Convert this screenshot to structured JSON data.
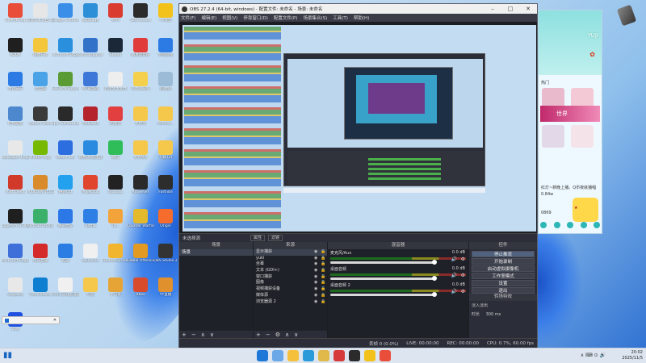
{
  "desktop": {
    "icons": [
      {
        "label": "Everything",
        "color": "#e84e3a"
      },
      {
        "label": "新建文本文档 (5).txt",
        "color": "#e6e6e6"
      },
      {
        "label": "Google Chrome",
        "color": "#3a8ee8"
      },
      {
        "label": "微软Edge",
        "color": "#2d8fd8"
      },
      {
        "label": "WPS",
        "color": "#d93b2f"
      },
      {
        "label": "OBS Studio",
        "color": "#2b2b2b"
      },
      {
        "label": "YY语音",
        "color": "#f2c21b"
      },
      {
        "label": "KOOK",
        "color": "#1f1f1f"
      },
      {
        "label": "快捷方式",
        "color": "#f3c63c"
      },
      {
        "label": "Microsoft Edge",
        "color": "#2a90dd"
      },
      {
        "label": "control_panel",
        "color": "#3272c9"
      },
      {
        "label": "Steam",
        "color": "#1b2838"
      },
      {
        "label": "网易云音乐",
        "color": "#e13c3c"
      },
      {
        "label": "夸克网盘",
        "color": "#2c7be5"
      },
      {
        "label": "更新日志",
        "color": "#2c7be5"
      },
      {
        "label": "此电脑",
        "color": "#4aa3e6"
      },
      {
        "label": "GeForce Experience",
        "color": "#5b9b34"
      },
      {
        "label": "MT管理器",
        "color": "#3d78d8"
      },
      {
        "label": "新建文本文档",
        "color": "#eeeeee"
      },
      {
        "label": "VirtualBox",
        "color": "#f5d04c"
      },
      {
        "label": "回收站",
        "color": "#9cbbd6"
      },
      {
        "label": "控制面板",
        "color": "#4d88cf"
      },
      {
        "label": "Nature Calls",
        "color": "#3a3a3a"
      },
      {
        "label": "Epic Games Launcher",
        "color": "#2a2a2a"
      },
      {
        "label": "WeGame",
        "color": "#b5242c"
      },
      {
        "label": "网易云",
        "color": "#e24040"
      },
      {
        "label": "文件夹",
        "color": "#f5c84c"
      },
      {
        "label": "Admini...",
        "color": "#f5c84c"
      },
      {
        "label": "Wallpaper Engine",
        "color": "#e8e8e8"
      },
      {
        "label": "NVIDIA App",
        "color": "#76b900"
      },
      {
        "label": "Battle.net",
        "color": "#2c6ee0"
      },
      {
        "label": "网易UU加速器",
        "color": "#2a8ae0"
      },
      {
        "label": "微信",
        "color": "#2fbd5a"
      },
      {
        "label": "文件夹2",
        "color": "#f5c84c"
      },
      {
        "label": "下载 (2)",
        "color": "#f5c84c"
      },
      {
        "label": "Riot Client",
        "color": "#d13a2b"
      },
      {
        "label": "PUBG BATTLEGR...",
        "color": "#d98b2b"
      },
      {
        "label": "腾讯QQ",
        "color": "#23a0ee"
      },
      {
        "label": "ProjectGo",
        "color": "#e0452d"
      },
      {
        "label": "Shadow",
        "color": "#222222"
      },
      {
        "label": "AirServer",
        "color": "#2a2a2a"
      },
      {
        "label": "Fortnite",
        "color": "#2d2d2d"
      },
      {
        "label": "Logitech G HUB",
        "color": "#1f1f1f"
      },
      {
        "label": "Android Studio",
        "color": "#3bb06b"
      },
      {
        "label": "腾讯会议",
        "color": "#2b78e6"
      },
      {
        "label": "Battle",
        "color": "#2d7fe5"
      },
      {
        "label": "Ta...",
        "color": "#f2a43b"
      },
      {
        "label": "Counter Warfare",
        "color": "#e5b92c"
      },
      {
        "label": "Origin",
        "color": "#f56c2d"
      },
      {
        "label": "Microsoft Edge Dev",
        "color": "#3f6fd8"
      },
      {
        "label": "虎牙直播",
        "color": "#d52a2a"
      },
      {
        "label": "迅雷",
        "color": "#2b7de3"
      },
      {
        "label": "Welcome",
        "color": "#f0f0f0"
      },
      {
        "label": "Counter-Strike 2",
        "color": "#f2b530"
      },
      {
        "label": "Global Offensive",
        "color": "#e39a22"
      },
      {
        "label": "OBS Studio 2",
        "color": "#333333"
      },
      {
        "label": "Snipaste",
        "color": "#e8e8e8"
      },
      {
        "label": "TeamViewer",
        "color": "#0e7ed0"
      },
      {
        "label": "5555 游戏加速器...",
        "color": "#f0f0f0"
      },
      {
        "label": "夸克",
        "color": "#f5c84c"
      },
      {
        "label": "小乌龟",
        "color": "#e7a436"
      },
      {
        "label": "Xbox",
        "color": "#d84b2c"
      },
      {
        "label": "YY直播",
        "color": "#e0902c"
      },
      {
        "label": "Vivo",
        "color": "#1f4fe0"
      }
    ]
  },
  "obs": {
    "title": "OBS 27.2.4 (64-bit, windows) - 配置文件: 未命名 - 场景: 未命名",
    "menu": [
      "文件(F)",
      "编辑(E)",
      "视图(V)",
      "停靠窗口(D)",
      "配置文件(P)",
      "场景集合(S)",
      "工具(T)",
      "帮助(H)"
    ],
    "no_source": "未选择源",
    "props_button": "属性",
    "filters_button": "滤镜",
    "docks": {
      "scenes": {
        "title": "场景",
        "items": [
          "场景"
        ]
      },
      "sources": {
        "title": "来源",
        "items": [
          "显示捕获",
          "yuki",
          "丝幕",
          "文本 (GDI+)",
          "窗口捕获",
          "图像",
          "视频捕获设备",
          "媒体源",
          "浏览器源 2"
        ]
      },
      "mixer": {
        "title": "混音器",
        "items": [
          {
            "name": "麦克风/Aux",
            "db": "0.0 dB"
          },
          {
            "name": "桌面音频",
            "db": "0.0 dB"
          },
          {
            "name": "桌面音频 2",
            "db": "0.0 dB"
          }
        ]
      },
      "transitions": {
        "title": "转场特效",
        "type": "淡入淡出",
        "duration_label": "时长",
        "duration": "300 ms"
      },
      "controls": {
        "title": "控件",
        "buttons": [
          "停止推流",
          "开始录制",
          "启动虚拟摄像机",
          "工作室模式",
          "设置",
          "退出"
        ]
      }
    },
    "status": {
      "live": "LIVE: 00:00:00",
      "rec": "REC: 00:00:00",
      "cpu": "CPU: 0.7%, 60.00 fps",
      "frames": "丢帧 0 (0.0%)"
    }
  },
  "side_window": {
    "name": "YUJI",
    "section1": "热门",
    "section2": "世界",
    "caption": "红灯~新晚上播。Q币夜就播唱",
    "stat1": "0.84w",
    "stat2": "0869"
  },
  "taskbar": {
    "time": "20:02",
    "date": "2025/11/5"
  },
  "mini_window": {
    "label": "正在..."
  }
}
